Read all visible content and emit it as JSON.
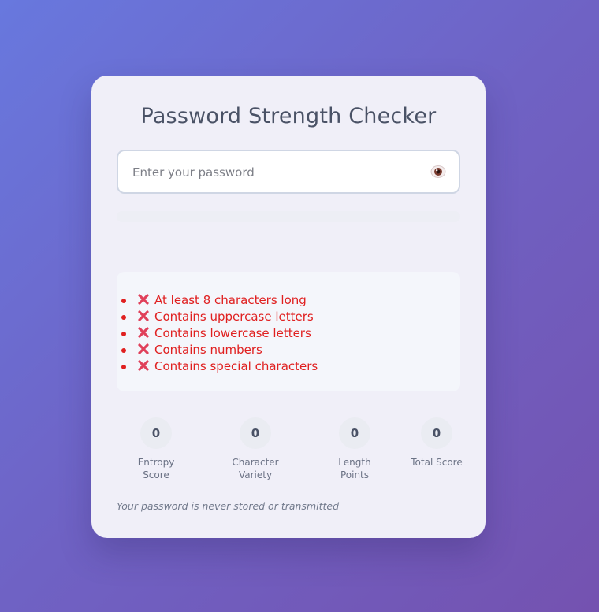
{
  "app": {
    "title": "Password Strength Checker"
  },
  "password_input": {
    "placeholder": "Enter your password",
    "value": ""
  },
  "toggle_visibility": {
    "icon": "eye-icon"
  },
  "strength_meter": {
    "level": 0
  },
  "requirements": [
    {
      "label": "At least 8 characters long",
      "met": false,
      "icon": "cross-mark-icon"
    },
    {
      "label": "Contains uppercase letters",
      "met": false,
      "icon": "cross-mark-icon"
    },
    {
      "label": "Contains lowercase letters",
      "met": false,
      "icon": "cross-mark-icon"
    },
    {
      "label": "Contains numbers",
      "met": false,
      "icon": "cross-mark-icon"
    },
    {
      "label": "Contains special characters",
      "met": false,
      "icon": "cross-mark-icon"
    }
  ],
  "stats": [
    {
      "value": "0",
      "label": "Entropy Score"
    },
    {
      "value": "0",
      "label": "Character Variety"
    },
    {
      "value": "0",
      "label": "Length Points"
    },
    {
      "value": "0",
      "label": "Total Score"
    }
  ],
  "footer_note": "Your password is never stored or transmitted",
  "colors": {
    "unmet": "#e02020",
    "title": "#4a5266"
  }
}
